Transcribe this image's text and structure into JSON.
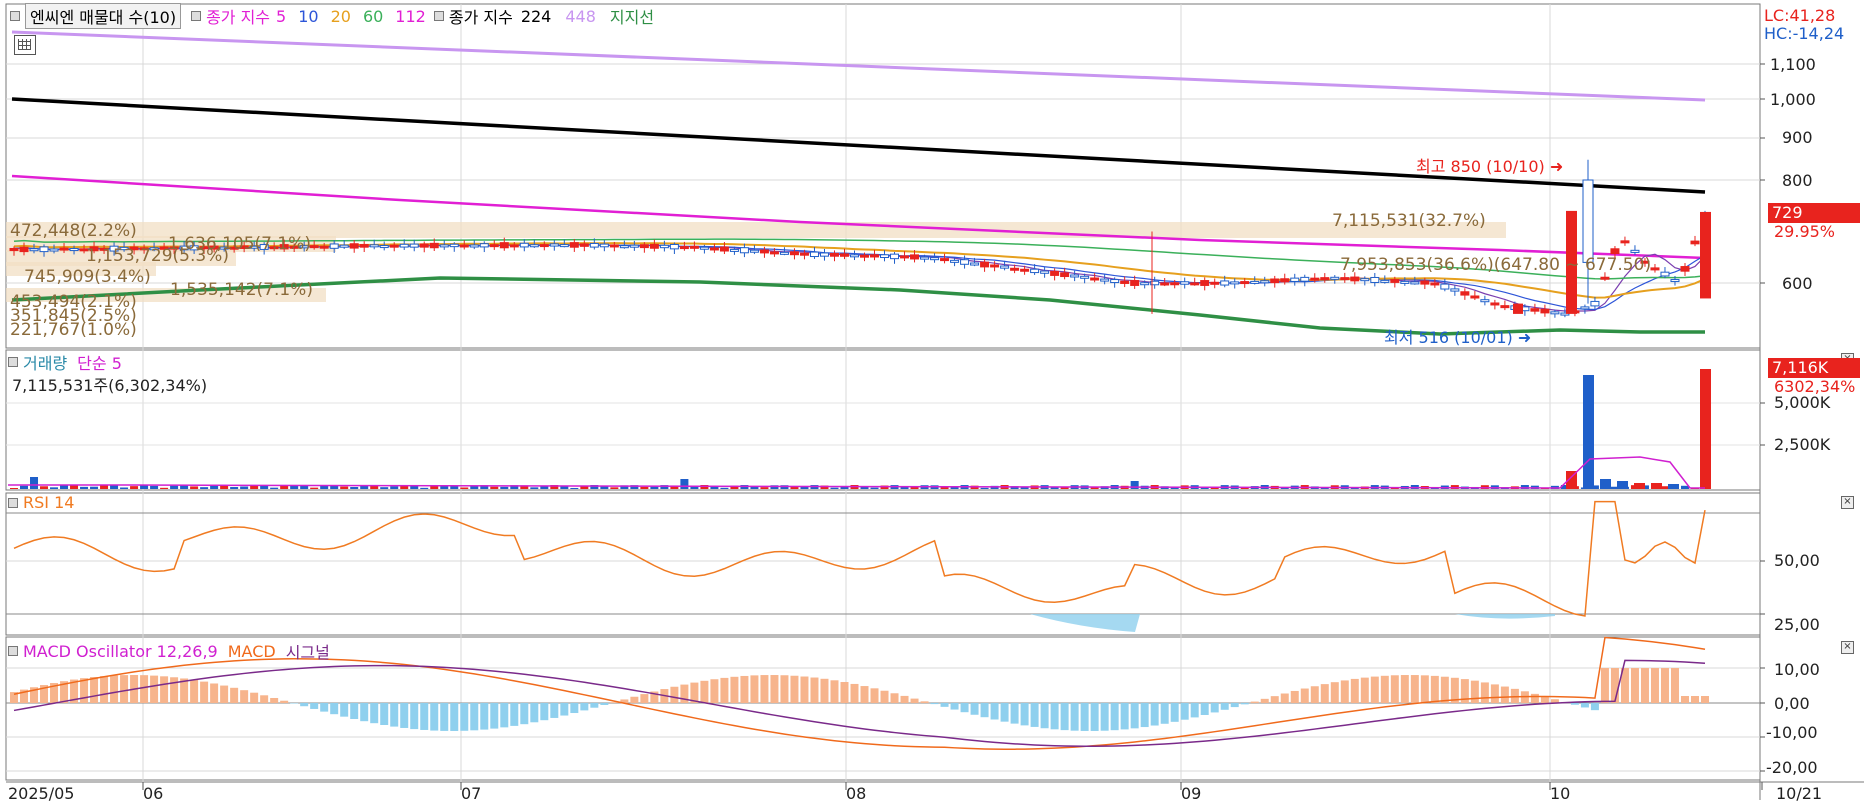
{
  "colors": {
    "up": "#e8231e",
    "down": "#1f5fc9",
    "ma5": "#7b3fb0",
    "ma10": "#2d55d8",
    "ma20": "#e6a01e",
    "ma60": "#3bb05a",
    "ma112": "#e11fd4",
    "ma224": "#000000",
    "ma448": "#c896f0",
    "support": "#2f8f45",
    "vol_ma": "#d020d0",
    "rsi": "#f07b22",
    "macd_line": "#f06a1c",
    "signal_line": "#7a2a8a",
    "osc_pos": "#f7b48c",
    "osc_neg": "#8fd0ee",
    "profile": "#f1dfc4"
  },
  "main_legend": {
    "title": "엔씨엔 매물대 수(10)",
    "ma_label": "종가 지수",
    "ma_5": "5",
    "ma_10": "10",
    "ma_20": "20",
    "ma_60": "60",
    "ma_112": "112",
    "ma2_label": "종가 지수",
    "ma_224": "224",
    "ma_448": "448",
    "support_label": "지지선"
  },
  "volume_legend": {
    "title": "거래량",
    "ma_label": "단순 5",
    "last_info": "7,115,531주(6,302,34%)"
  },
  "rsi_legend": {
    "title": "RSI 14"
  },
  "macd_legend": {
    "osc": "MACD Oscillator 12,26,9",
    "macd": "MACD",
    "signal": "시그널"
  },
  "right_info": {
    "lc": "LC:41,28",
    "hc": "HC:-14,24"
  },
  "price_axis": {
    "ticks": [
      "1,100",
      "1,000",
      "900",
      "800",
      "600"
    ],
    "last_price": "729",
    "last_change": "29.95%"
  },
  "volume_axis": {
    "ticks": [
      "5,000K",
      "2,500K"
    ],
    "last_volume": "7,116K",
    "last_ratio": "6302,34%"
  },
  "rsi_axis": {
    "ticks": [
      "50,00",
      "25,00"
    ]
  },
  "macd_axis": {
    "ticks": [
      "10,00",
      "0,00",
      "-10,00",
      "-20,00"
    ]
  },
  "date_axis": {
    "labels": [
      "2025/05",
      "06",
      "07",
      "08",
      "09",
      "10",
      "10/21"
    ]
  },
  "annotations": {
    "high": "최고 850 (10/10)",
    "low": "최저 516 (10/01)",
    "profile_top": "7,115,531(32.7%)",
    "profile_mid": "7,953,853(36.6%)(647.80 ~ 677.50)"
  },
  "profile_labels": [
    "472,448(2.2%)",
    "1,636,105(7.1%)",
    "1,153,729(5.3%)",
    "745,909(3.4%)",
    "1,535,142(7.1%)",
    "453,494(2.1%)",
    "351,845(2.5%)",
    "221,767(1.0%)"
  ],
  "chart_data": {
    "type": "candlestick",
    "period": "2025/05 - 10/21",
    "price": {
      "high_annot": 850,
      "low_annot": 516,
      "last_close": 729
    },
    "axis_ticks_price": [
      1100,
      1000,
      900,
      800,
      600
    ],
    "volume_last": 7115531,
    "rsi_period": 14,
    "rsi_levels": [
      50,
      25
    ],
    "macd_params": [
      12,
      26,
      9
    ]
  }
}
